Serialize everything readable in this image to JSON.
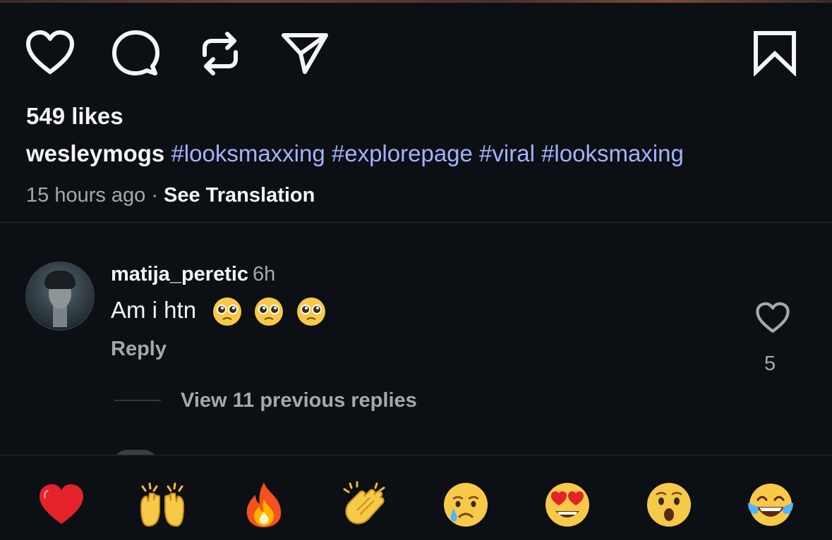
{
  "post": {
    "likes": "549 likes",
    "username": "wesleymogs",
    "hashtags": "#looksmaxxing #explorepage #viral #looksmaxing",
    "time_ago": "15 hours ago",
    "separator": "·",
    "see_translation": "See Translation"
  },
  "actions": {
    "icons": [
      "heart-icon",
      "comment-icon",
      "repost-icon",
      "share-icon",
      "bookmark-icon"
    ]
  },
  "comment": {
    "username": "matija_peretic",
    "time": "6h",
    "text": "Am i htn",
    "emoji_icons": [
      "pleading-face-icon",
      "pleading-face-icon",
      "pleading-face-icon"
    ],
    "reply_label": "Reply",
    "like_count": "5",
    "view_replies": "View 11 previous replies"
  },
  "reactions": [
    "red-heart-icon",
    "raising-hands-icon",
    "fire-icon",
    "clapping-hands-icon",
    "crying-face-icon",
    "heart-eyes-icon",
    "astonished-face-icon",
    "tears-of-joy-icon"
  ],
  "colors": {
    "background": "#0c0f14",
    "hashtag": "#a3b3ff",
    "secondary_text": "#a6a8ad",
    "primary_text": "#f5f5f5"
  }
}
